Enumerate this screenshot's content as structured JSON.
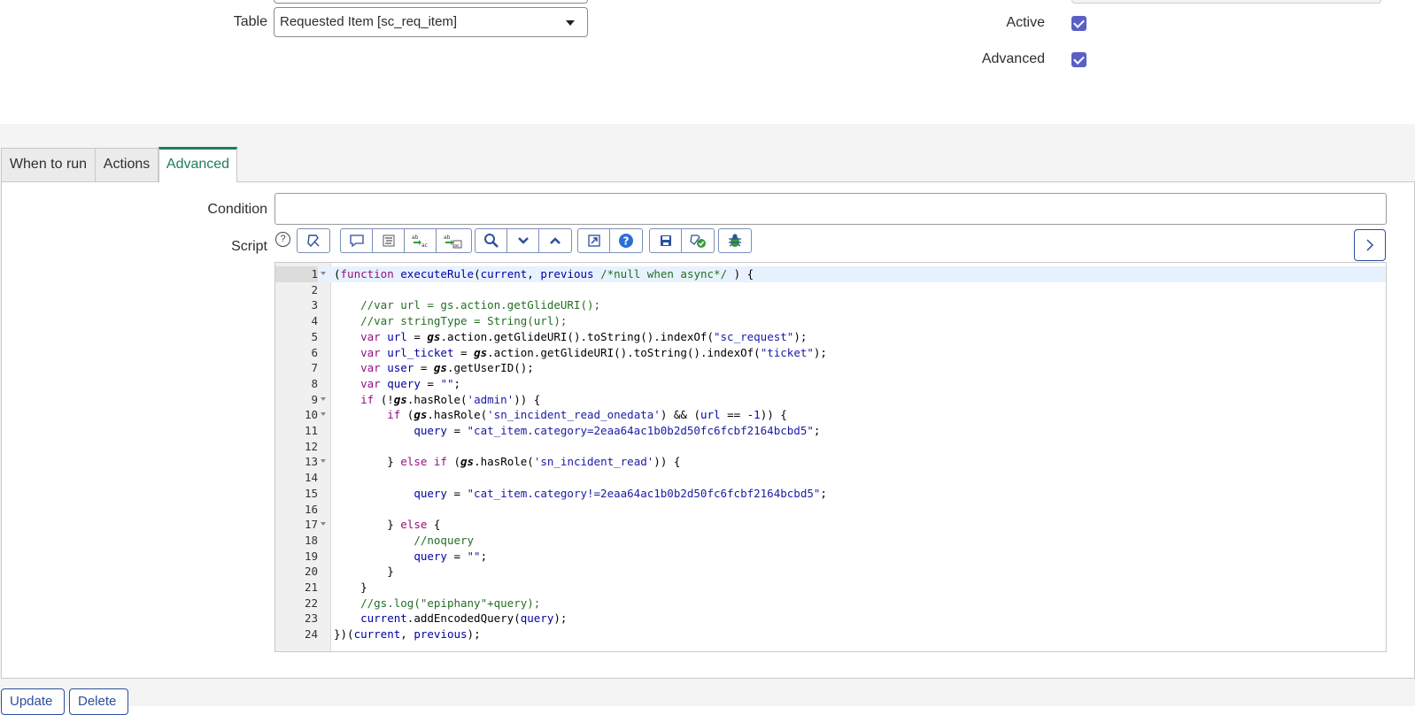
{
  "form": {
    "table_label": "Table",
    "table_value": "Requested Item [sc_req_item]",
    "active_label": "Active",
    "active_checked": true,
    "advanced_label": "Advanced",
    "advanced_checked": true
  },
  "tabs": [
    {
      "label": "When to run",
      "active": false
    },
    {
      "label": "Actions",
      "active": false
    },
    {
      "label": "Advanced",
      "active": true
    }
  ],
  "advanced": {
    "condition_label": "Condition",
    "condition_value": "",
    "script_label": "Script",
    "help_glyph": "?"
  },
  "toolbar": {
    "groups": [
      [
        "format-script-icon"
      ],
      [
        "comment-icon",
        "format-code-icon",
        "replace-icon",
        "replace-all-icon"
      ],
      [
        "search-icon",
        "collapse-down-icon",
        "collapse-up-icon"
      ],
      [
        "fullscreen-icon",
        "help-icon"
      ],
      [
        "save-icon",
        "check-syntax-icon"
      ],
      [
        "debug-icon"
      ]
    ]
  },
  "script_lines": [
    "(function executeRule(current, previous /*null when async*/ ) {",
    "",
    "    //var url = gs.action.getGlideURI();",
    "    //var stringType = String(url);",
    "    var url = gs.action.getGlideURI().toString().indexOf(\"sc_request\");",
    "    var url_ticket = gs.action.getGlideURI().toString().indexOf(\"ticket\");",
    "    var user = gs.getUserID();",
    "    var query = \"\";",
    "    if (!gs.hasRole('admin')) {",
    "        if (gs.hasRole('sn_incident_read_onedata') && (url == -1)) {",
    "            query = \"cat_item.category=2eaa64ac1b0b2d50fc6fcbf2164bcbd5\";",
    "",
    "        } else if (gs.hasRole('sn_incident_read')) {",
    "",
    "            query = \"cat_item.category!=2eaa64ac1b0b2d50fc6fcbf2164bcbd5\";",
    "",
    "        } else {",
    "            //noquery",
    "            query = \"\";",
    "        }",
    "    }",
    "    //gs.log(\"epiphany\"+query);",
    "    current.addEncodedQuery(query);",
    "})(current, previous);"
  ],
  "fold_lines": [
    1,
    9,
    10,
    13,
    17
  ],
  "buttons": {
    "update_label": "Update",
    "delete_label": "Delete"
  },
  "colors": {
    "accent": "#1f7d58",
    "checkbox": "#5b5fc7",
    "link": "#2b4f9b"
  }
}
